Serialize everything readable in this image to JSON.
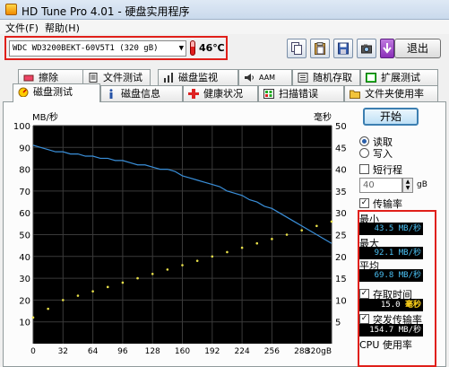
{
  "window": {
    "title": "HD Tune Pro 4.01 - 硬盘实用程序"
  },
  "menu": [
    {
      "label": "文件(F)"
    },
    {
      "label": "帮助(H)"
    }
  ],
  "toolbar": {
    "drive": "WDC WD3200BEKT-60V5T1     (320 gB)",
    "temperature": "46℃",
    "exit_label": "退出",
    "icons": [
      "copy-icon",
      "paste-icon",
      "save-icon",
      "camera-icon",
      "download-icon"
    ]
  },
  "tabs_row1": [
    {
      "label": "擦除",
      "icon": "eraser-icon"
    },
    {
      "label": "文件测试",
      "icon": "file-test-icon"
    },
    {
      "label": "磁盘监视",
      "icon": "monitor-icon"
    },
    {
      "label": "AAM",
      "icon": "speaker-icon"
    },
    {
      "label": "随机存取",
      "icon": "random-access-icon"
    },
    {
      "label": "扩展测试",
      "icon": "extra-tests-icon"
    }
  ],
  "tabs_row2": [
    {
      "label": "磁盘测试",
      "icon": "benchmark-icon",
      "active": true
    },
    {
      "label": "磁盘信息",
      "icon": "info-icon"
    },
    {
      "label": "健康状况",
      "icon": "health-icon"
    },
    {
      "label": "扫描错误",
      "icon": "scan-icon"
    },
    {
      "label": "文件夹使用率",
      "icon": "folder-icon"
    }
  ],
  "controls": {
    "start_label": "开始",
    "read_label": "读取",
    "write_label": "写入",
    "short_stroke_label": "短行程",
    "short_stroke_value": "40",
    "short_stroke_unit": "gB",
    "transfer_rate_label": "传输率",
    "min_label": "最小",
    "min_value": "43.5",
    "max_label": "最大",
    "max_value": "92.1",
    "avg_label": "平均",
    "avg_value": "69.8",
    "rate_unit": "MB/秒",
    "access_time_label": "存取时间",
    "access_time_value": "15.0",
    "access_time_unit": "毫秒",
    "burst_rate_label": "突发传输率",
    "burst_rate_value": "154.7",
    "cpu_usage_label": "CPU 使用率"
  },
  "colors": {
    "transfer_line": "#3a8fd9",
    "access_dots": "#e8e04a",
    "graph_bg": "#000000",
    "highlight": "#e0201a"
  },
  "chart_data": {
    "type": "line",
    "xlabel": "gB",
    "x_ticks": [
      "0",
      "32",
      "64",
      "96",
      "128",
      "160",
      "192",
      "224",
      "256",
      "288",
      "320gB"
    ],
    "left_axis": {
      "label": "MB/秒",
      "ticks": [
        "100",
        "90",
        "80",
        "70",
        "60",
        "50",
        "40",
        "30",
        "20",
        "10"
      ],
      "ylim": [
        0,
        100
      ]
    },
    "right_axis": {
      "label": "毫秒",
      "ticks": [
        "50",
        "45",
        "40",
        "35",
        "30",
        "25",
        "20",
        "15",
        "10",
        "5"
      ],
      "ylim": [
        0,
        50
      ]
    },
    "series": [
      {
        "name": "传输率",
        "unit": "MB/秒",
        "x": [
          0,
          8,
          16,
          24,
          32,
          40,
          48,
          56,
          64,
          72,
          80,
          88,
          96,
          104,
          112,
          120,
          128,
          136,
          144,
          152,
          160,
          168,
          176,
          184,
          192,
          200,
          208,
          216,
          224,
          232,
          240,
          248,
          256,
          264,
          272,
          280,
          288,
          296,
          304,
          312,
          320
        ],
        "y": [
          91,
          90,
          89,
          88,
          88,
          87,
          87,
          86,
          86,
          85,
          85,
          84,
          84,
          83,
          82,
          82,
          81,
          80,
          80,
          79,
          77,
          76,
          75,
          74,
          73,
          72,
          70,
          69,
          68,
          66,
          65,
          63,
          62,
          60,
          58,
          56,
          54,
          52,
          50,
          48,
          46
        ]
      },
      {
        "name": "存取时间",
        "unit": "毫秒",
        "type": "scatter",
        "x": [
          0,
          16,
          32,
          48,
          64,
          80,
          96,
          112,
          128,
          144,
          160,
          176,
          192,
          208,
          224,
          240,
          256,
          272,
          288,
          304,
          320
        ],
        "y": [
          6,
          8,
          10,
          11,
          12,
          13,
          14,
          15,
          16,
          17,
          18,
          19,
          20,
          21,
          22,
          23,
          24,
          25,
          26,
          27,
          28
        ]
      }
    ]
  }
}
